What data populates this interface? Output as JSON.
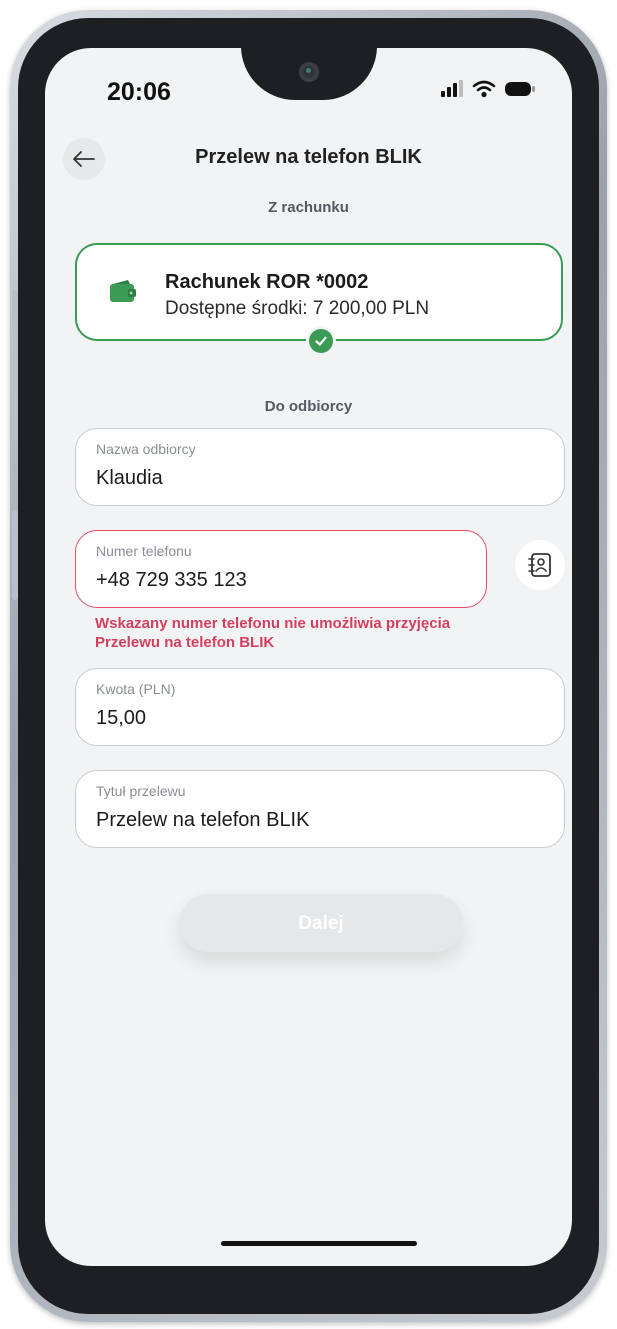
{
  "status_bar": {
    "time": "20:06",
    "icons": [
      "signal-icon",
      "wifi-icon",
      "battery-icon"
    ]
  },
  "header": {
    "title": "Przelew na telefon BLIK",
    "back_icon": "arrow-left-icon"
  },
  "from_section": {
    "label": "Z rachunku",
    "account_name": "Rachunek ROR *0002",
    "available_funds": "Dostępne środki: 7 200,00 PLN",
    "icon": "wallet-icon",
    "selected": true
  },
  "to_section": {
    "label": "Do odbiorcy",
    "recipient_name": {
      "label": "Nazwa odbiorcy",
      "value": "Klaudia"
    },
    "phone_number": {
      "label": "Numer telefonu",
      "value": "+48 729 335 123"
    },
    "contacts_icon": "contact-book-icon",
    "error": "Wskazany numer telefonu nie umożliwia przyjęcia Przelewu na telefon BLIK",
    "amount": {
      "label": "Kwota (PLN)",
      "value": "15,00"
    },
    "title": {
      "label": "Tytuł przelewu",
      "value": "Przelew na telefon BLIK"
    }
  },
  "next_button": {
    "label": "Dalej",
    "enabled": false
  },
  "colors": {
    "accent_green": "#3b9a54",
    "error_red": "#d53f5e",
    "screen_bg": "#f1f3f4"
  }
}
